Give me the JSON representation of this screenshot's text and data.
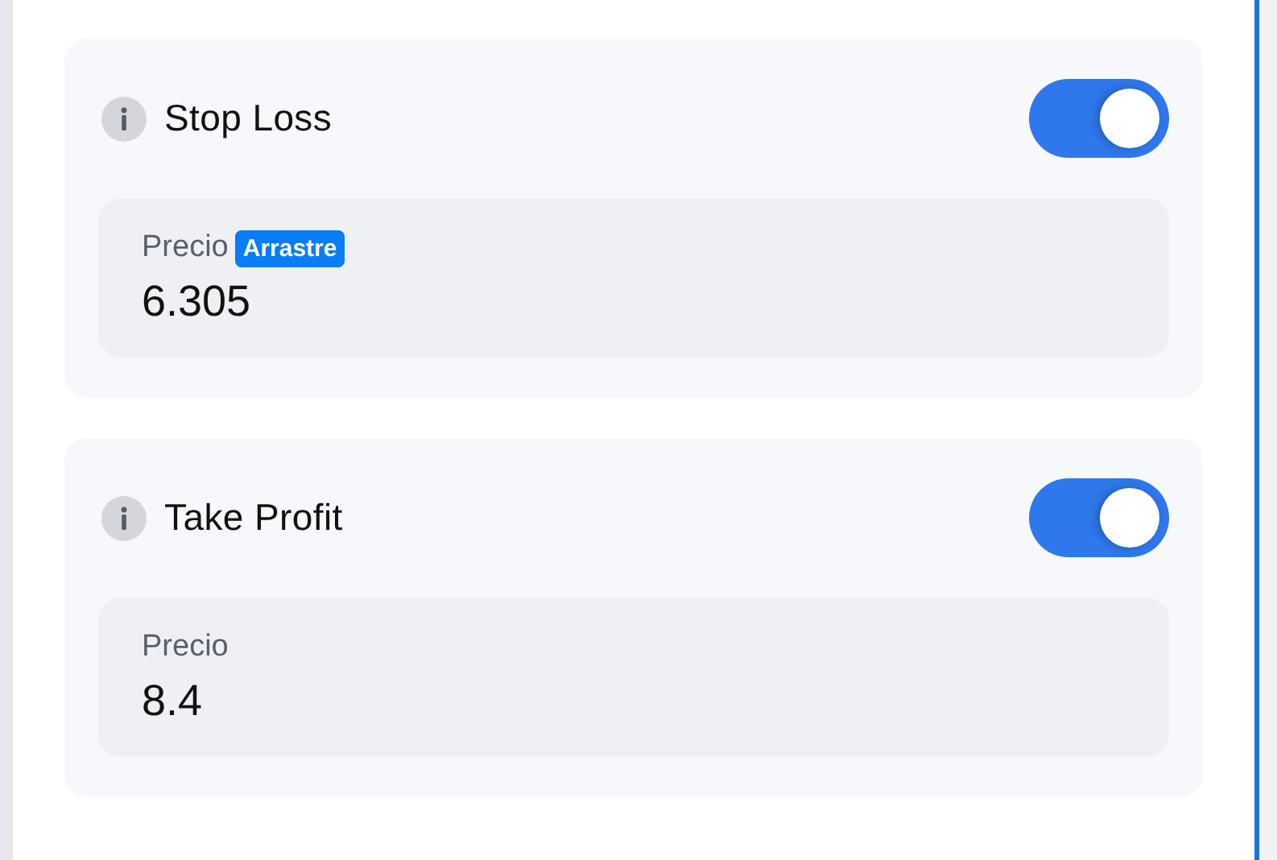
{
  "sections": [
    {
      "title": "Stop Loss",
      "enabled": true,
      "field": {
        "label": "Precio",
        "badge": "Arrastre",
        "value": "6.305"
      }
    },
    {
      "title": "Take Profit",
      "enabled": true,
      "field": {
        "label": "Precio",
        "value": "8.4"
      }
    }
  ]
}
